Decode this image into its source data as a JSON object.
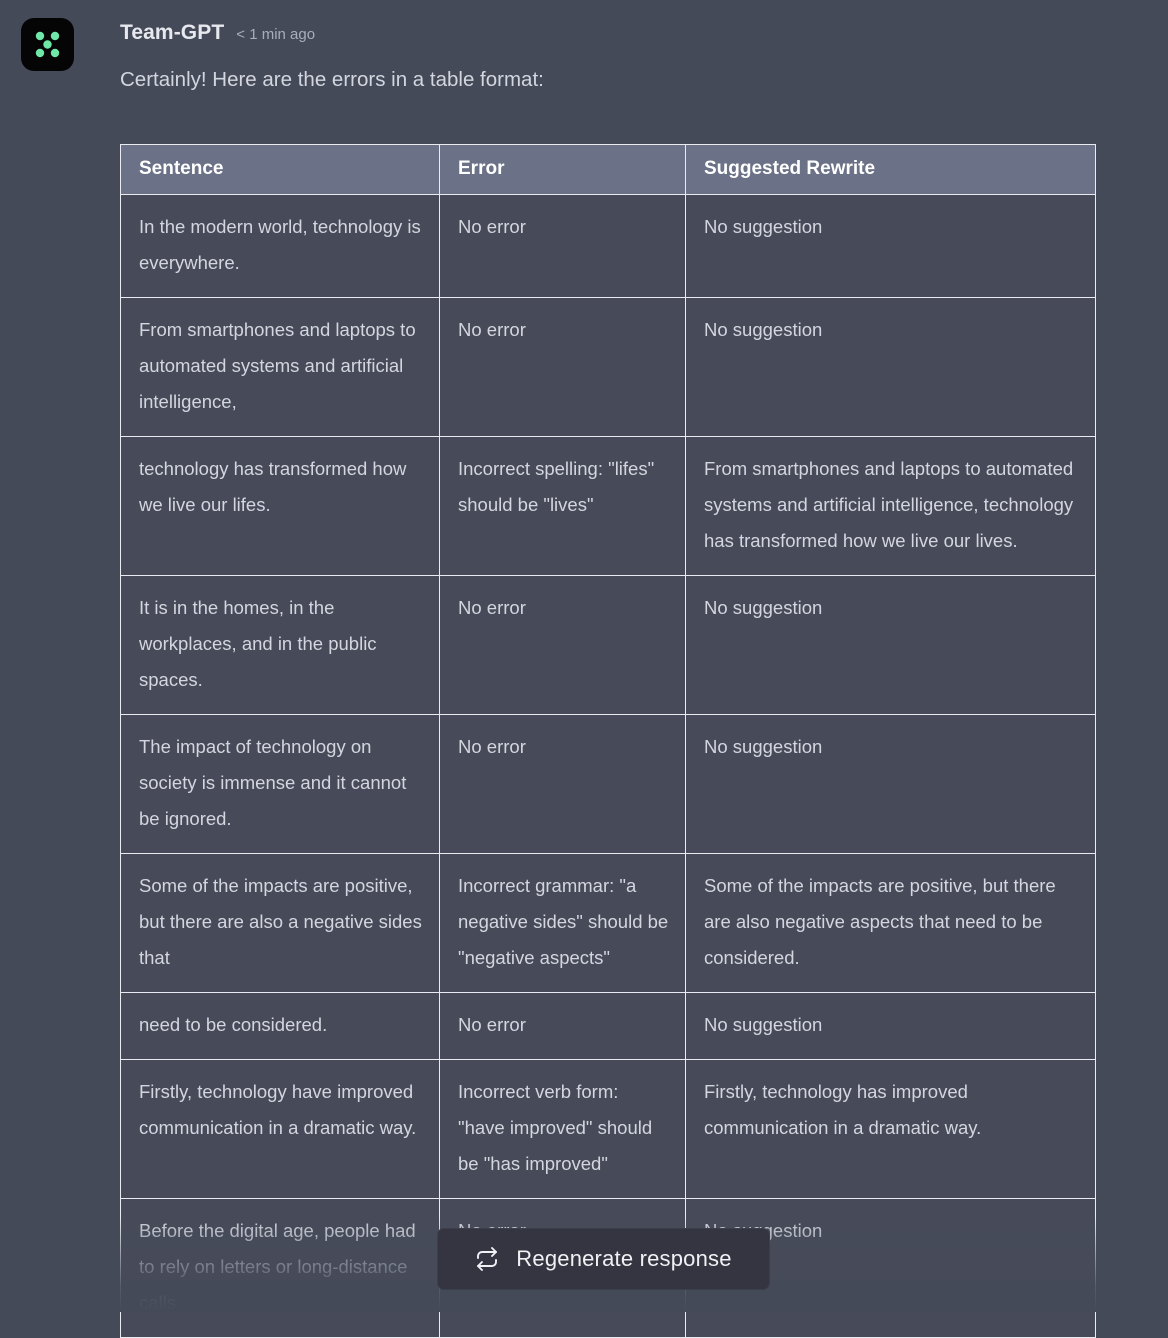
{
  "message": {
    "author": "Team-GPT",
    "timestamp": "< 1 min ago",
    "intro": "Certainly! Here are the errors in a table format:",
    "avatar_icon": "five-dot-grid-icon",
    "avatar_bg": "#050505",
    "avatar_dot_color": "#6ee7a8"
  },
  "theme": {
    "page_bg": "#454a59",
    "table_header_bg": "#6b7186",
    "table_cell_bg": "#474b59",
    "table_border": "#e9ebf0",
    "text_primary": "#d3d6de",
    "button_bg": "#343541"
  },
  "table": {
    "columns": [
      "Sentence",
      "Error",
      "Suggested Rewrite"
    ],
    "rows": [
      {
        "sentence": "In the modern world, technology is everywhere.",
        "error": "No error",
        "rewrite": "No suggestion"
      },
      {
        "sentence": "From smartphones and laptops to automated systems and artificial intelligence,",
        "error": "No error",
        "rewrite": "No suggestion"
      },
      {
        "sentence": "technology has transformed how we live our lifes.",
        "error": "Incorrect spelling: \"lifes\" should be \"lives\"",
        "rewrite": "From smartphones and laptops to automated systems and artificial intelligence, technology has transformed how we live our lives."
      },
      {
        "sentence": "It is in the homes, in the workplaces, and in the public spaces.",
        "error": "No error",
        "rewrite": "No suggestion"
      },
      {
        "sentence": "The impact of technology on society is immense and it cannot be ignored.",
        "error": "No error",
        "rewrite": "No suggestion"
      },
      {
        "sentence": "Some of the impacts are positive, but there are also a negative sides that",
        "error": "Incorrect grammar: \"a negative sides\" should be \"negative aspects\"",
        "rewrite": "Some of the impacts are positive, but there are also negative aspects that need to be considered."
      },
      {
        "sentence": "need to be considered.",
        "error": "No error",
        "rewrite": "No suggestion"
      },
      {
        "sentence": "Firstly, technology have improved communication in a dramatic way.",
        "error": "Incorrect verb form: \"have improved\" should be \"has improved\"",
        "rewrite": "Firstly, technology has improved communication in a dramatic way."
      },
      {
        "sentence": "Before the digital age, people had to rely on letters or long-distance calls",
        "error": "No error",
        "rewrite": "No suggestion"
      }
    ]
  },
  "regenerate": {
    "label": "Regenerate response",
    "icon": "repeat-icon"
  }
}
